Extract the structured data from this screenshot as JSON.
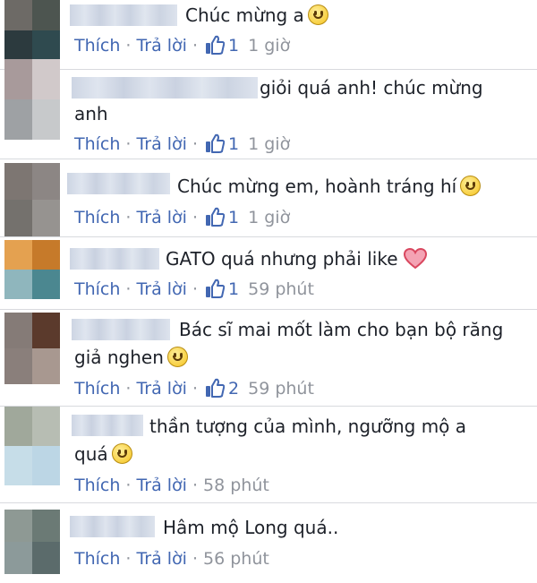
{
  "like_label": "Thích",
  "reply_label": "Trả lời",
  "separator": "·",
  "comments": [
    {
      "line1": "Chúc mừng a",
      "line2": "",
      "emoji": "smile",
      "likes": "1",
      "time": "1 giờ",
      "avatar_colors": [
        "#6d6a66",
        "#4d5550",
        "#2c3a3e",
        "#2f4a4f"
      ]
    },
    {
      "line1": "giỏi quá anh! chúc mừng",
      "line2": "anh",
      "emoji": "",
      "likes": "1",
      "time": "1 giờ",
      "avatar_colors": [
        "#a89a9b",
        "#d1c9ca",
        "#9ea1a4",
        "#c7c9cb"
      ]
    },
    {
      "line1": "Chúc mừng em, hoành tráng hí",
      "line2": "",
      "emoji": "smile",
      "likes": "1",
      "time": "1 giờ",
      "avatar_colors": [
        "#7d7672",
        "#8c8684",
        "#74716d",
        "#969390"
      ]
    },
    {
      "line1": "GATO quá nhưng phải like",
      "line2": "",
      "emoji": "heart",
      "likes": "1",
      "time": "59 phút",
      "avatar_colors": [
        "#e4a150",
        "#c67a2a",
        "#8fb6bd",
        "#4b8790"
      ]
    },
    {
      "line1": "Bác sĩ mai mốt làm cho bạn bộ răng",
      "line2": "giả nghen",
      "emoji": "smile",
      "likes": "2",
      "time": "59 phút",
      "avatar_colors": [
        "#857b77",
        "#5b3a2c",
        "#8a7f7b",
        "#a89890"
      ]
    },
    {
      "line1": "thần tượng của mình, ngưỡng mộ a",
      "line2": "quá",
      "emoji": "smile",
      "likes": "",
      "time": "58 phút",
      "avatar_colors": [
        "#a0a89b",
        "#b7bdb3",
        "#c6dde8",
        "#bcd6e5"
      ]
    },
    {
      "line1": "Hâm mộ Long quá..",
      "line2": "",
      "emoji": "",
      "likes": "",
      "time": "56 phút",
      "avatar_colors": [
        "#8e9994",
        "#6b7a75",
        "#8c9a9a",
        "#5b6b6b"
      ]
    }
  ]
}
